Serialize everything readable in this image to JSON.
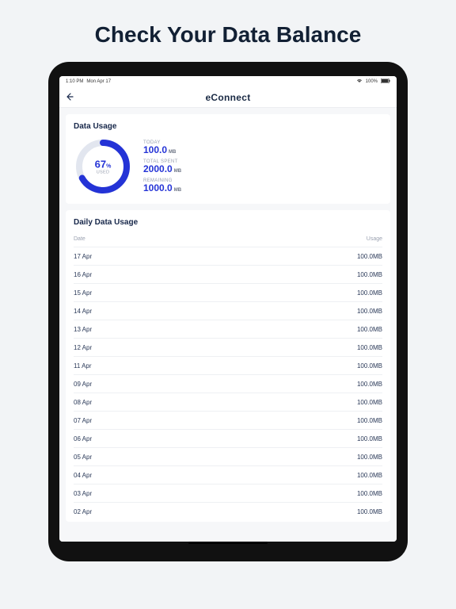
{
  "promo": {
    "title": "Check Your Data Balance"
  },
  "status": {
    "time": "1:10 PM",
    "date": "Mon Apr 17",
    "battery": "100%"
  },
  "header": {
    "brand": "eConnect"
  },
  "usage_card": {
    "title": "Data Usage",
    "percent_value": "67",
    "percent_unit": "%",
    "used_label": "USED",
    "stats": [
      {
        "label": "TODAY",
        "value": "100.0",
        "unit": "MB"
      },
      {
        "label": "TOTAL SPENT",
        "value": "2000.0",
        "unit": "MB"
      },
      {
        "label": "REMAINING",
        "value": "1000.0",
        "unit": "MB"
      }
    ]
  },
  "daily_card": {
    "title": "Daily Data Usage",
    "col_date": "Date",
    "col_usage": "Usage",
    "rows": [
      {
        "date": "17 Apr",
        "usage": "100.0MB"
      },
      {
        "date": "16 Apr",
        "usage": "100.0MB"
      },
      {
        "date": "15 Apr",
        "usage": "100.0MB"
      },
      {
        "date": "14 Apr",
        "usage": "100.0MB"
      },
      {
        "date": "13 Apr",
        "usage": "100.0MB"
      },
      {
        "date": "12 Apr",
        "usage": "100.0MB"
      },
      {
        "date": "11 Apr",
        "usage": "100.0MB"
      },
      {
        "date": "09 Apr",
        "usage": "100.0MB"
      },
      {
        "date": "08 Apr",
        "usage": "100.0MB"
      },
      {
        "date": "07 Apr",
        "usage": "100.0MB"
      },
      {
        "date": "06 Apr",
        "usage": "100.0MB"
      },
      {
        "date": "05 Apr",
        "usage": "100.0MB"
      },
      {
        "date": "04 Apr",
        "usage": "100.0MB"
      },
      {
        "date": "03 Apr",
        "usage": "100.0MB"
      },
      {
        "date": "02 Apr",
        "usage": "100.0MB"
      }
    ]
  },
  "chart_data": {
    "type": "pie",
    "title": "Data Usage",
    "categories": [
      "Used",
      "Remaining"
    ],
    "values": [
      67,
      33
    ],
    "ylabel": "%"
  }
}
